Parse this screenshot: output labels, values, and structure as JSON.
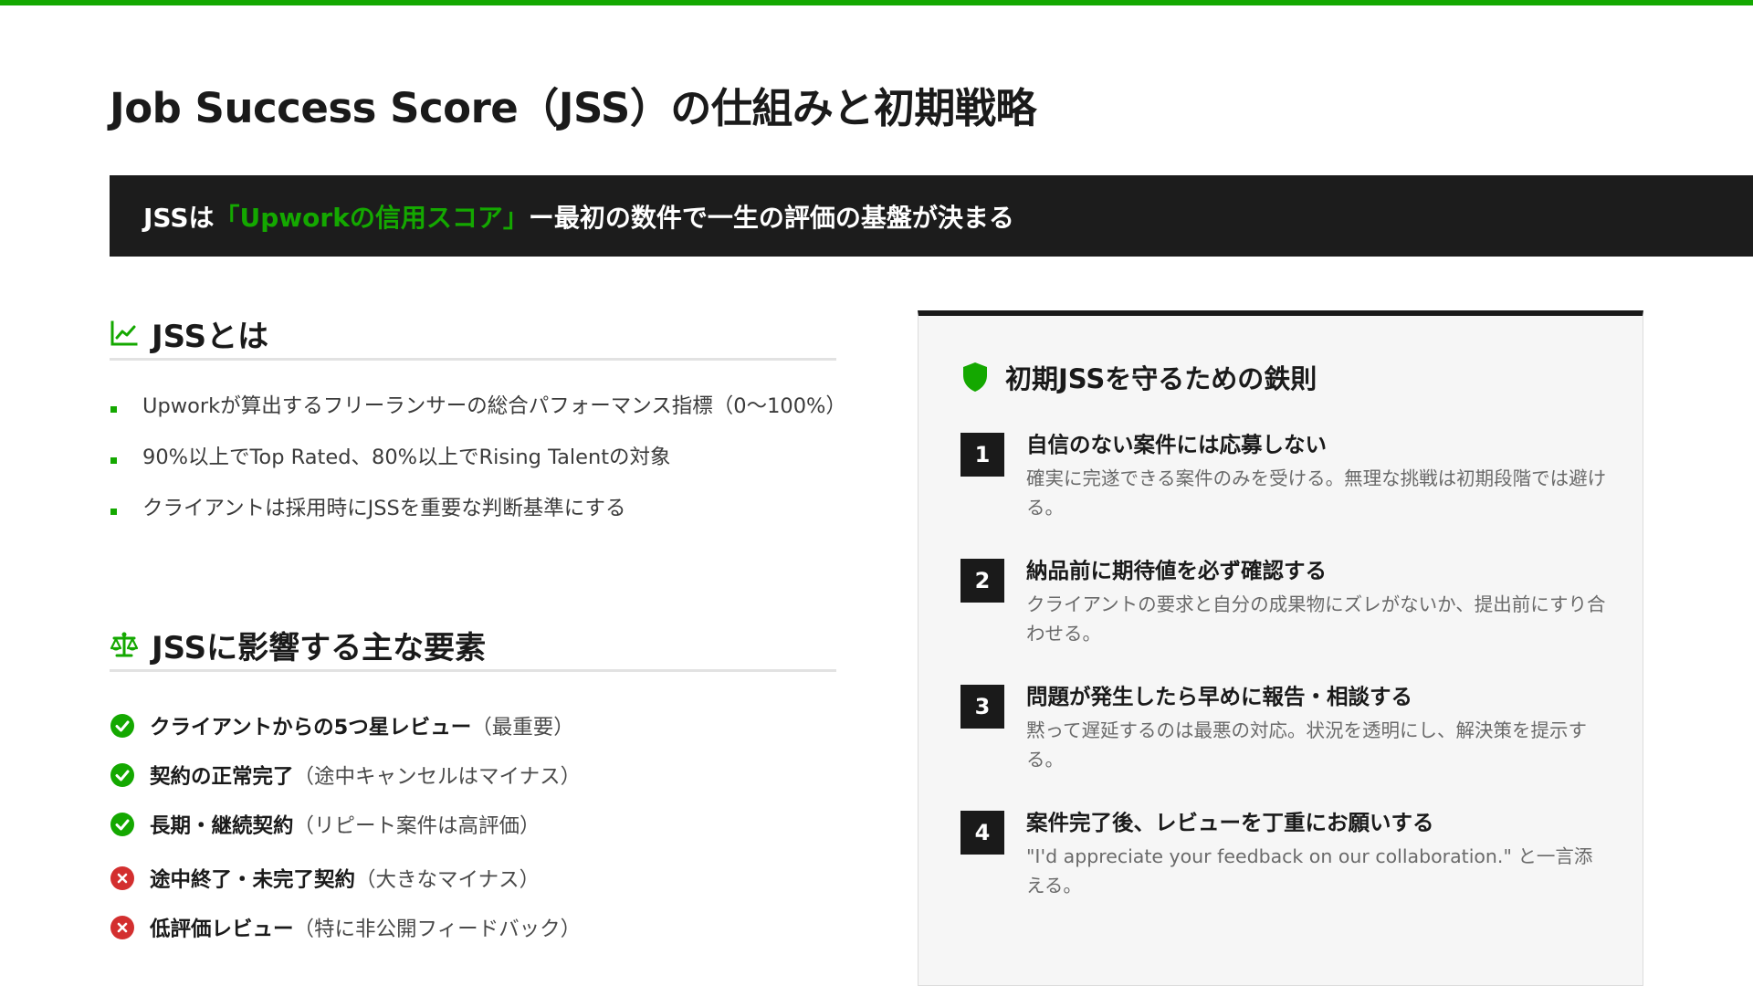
{
  "title": "Job Success Score（JSS）の仕組みと初期戦略",
  "banner": {
    "prefix": "JSSは",
    "highlight": "「Upworkの信用スコア」",
    "suffix": "ー最初の数件で一生の評価の基盤が決まる"
  },
  "section_about": {
    "heading": "JSSとは",
    "icon": "chart-line-icon",
    "bullets": [
      "Upworkが算出するフリーランサーの総合パフォーマンス指標（0〜100%）",
      "90%以上でTop Rated、80%以上でRising Talentの対象",
      "クライアントは採用時にJSSを重要な判断基準にする"
    ]
  },
  "section_factors": {
    "heading": "JSSに影響する主な要素",
    "icon": "scale-icon",
    "items": [
      {
        "label": "クライアントからの5つ星レビュー",
        "note": "（最重要）",
        "type": "positive"
      },
      {
        "label": "契約の正常完了",
        "note": "（途中キャンセルはマイナス）",
        "type": "positive"
      },
      {
        "label": "長期・継続契約",
        "note": "（リピート案件は高評価）",
        "type": "positive"
      },
      {
        "label": "途中終了・未完了契約",
        "note": "（大きなマイナス）",
        "type": "negative"
      },
      {
        "label": "低評価レビュー",
        "note": "（特に非公開フィードバック）",
        "type": "negative"
      }
    ]
  },
  "rules_card": {
    "heading": "初期JSSを守るための鉄則",
    "icon": "shield-icon",
    "rules": [
      {
        "num": "1",
        "title": "自信のない案件には応募しない",
        "desc": "確実に完遂できる案件のみを受ける。無理な挑戦は初期段階では避ける。"
      },
      {
        "num": "2",
        "title": "納品前に期待値を必ず確認する",
        "desc": "クライアントの要求と自分の成果物にズレがないか、提出前にすり合わせる。"
      },
      {
        "num": "3",
        "title": "問題が発生したら早めに報告・相談する",
        "desc": "黙って遅延するのは最悪の対応。状況を透明にし、解決策を提示する。"
      },
      {
        "num": "4",
        "title": "案件完了後、レビューを丁重にお願いする",
        "desc": "\"I'd appreciate your feedback on our collaboration.\" と一言添える。"
      }
    ]
  },
  "colors": {
    "accent": "#14a800",
    "dark": "#1c1c1c",
    "negative": "#d32f2f",
    "card_bg": "#f6f6f6"
  }
}
